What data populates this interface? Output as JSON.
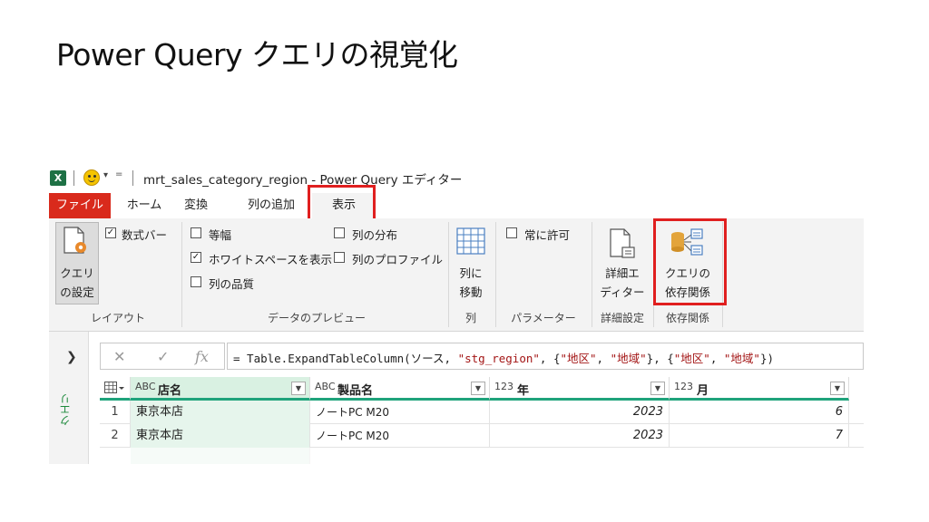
{
  "slide": {
    "title": "Power Query クエリの視覚化"
  },
  "titlebar": {
    "app_icon": "X",
    "window_title": "mrt_sales_category_region - Power Query エディター",
    "qat_caret": "▾",
    "qat_more": "="
  },
  "tabs": [
    "ファイル",
    "ホーム",
    "変換",
    "列の追加",
    "表示"
  ],
  "ribbon": {
    "layout": {
      "query_settings_line1": "クエリ",
      "query_settings_line2": "の設定",
      "formula_bar": "数式バー",
      "label": "レイアウト"
    },
    "preview": {
      "monospace": "等幅",
      "whitespace": "ホワイトスペースを表示",
      "column_quality": "列の品質",
      "column_distribution": "列の分布",
      "column_profile": "列のプロファイル",
      "label": "データのプレビュー"
    },
    "columns": {
      "goto_line1": "列に",
      "goto_line2": "移動",
      "label": "列"
    },
    "parameters": {
      "always_allow": "常に許可",
      "label": "パラメーター"
    },
    "advanced": {
      "editor_line1": "詳細エ",
      "editor_line2": "ディター",
      "label": "詳細設定"
    },
    "dependencies": {
      "btn_line1": "クエリの",
      "btn_line2": "依存関係",
      "label": "依存関係"
    }
  },
  "leftpanel": {
    "label": "クエリ"
  },
  "formula": {
    "prefix": "= Table.ExpandTableColumn(ソース, ",
    "s1": "\"stg_region\"",
    "mid1": ", {",
    "s2": "\"地区\"",
    "mid2": ", ",
    "s3": "\"地域\"",
    "mid3": "}, {",
    "s4": "\"地区\"",
    "mid4": ", ",
    "s5": "\"地域\"",
    "suffix": "})"
  },
  "grid": {
    "columns": [
      {
        "type": "ABC",
        "name": "店名"
      },
      {
        "type": "ABC",
        "name": "製品名"
      },
      {
        "type": "123",
        "name": "年"
      },
      {
        "type": "123",
        "name": "月"
      }
    ],
    "rows": [
      {
        "idx": "1",
        "store": "東京本店",
        "product": "ノートPC M20",
        "year": "2023",
        "month": "6"
      },
      {
        "idx": "2",
        "store": "東京本店",
        "product": "ノートPC M20",
        "year": "2023",
        "month": "7"
      }
    ]
  }
}
